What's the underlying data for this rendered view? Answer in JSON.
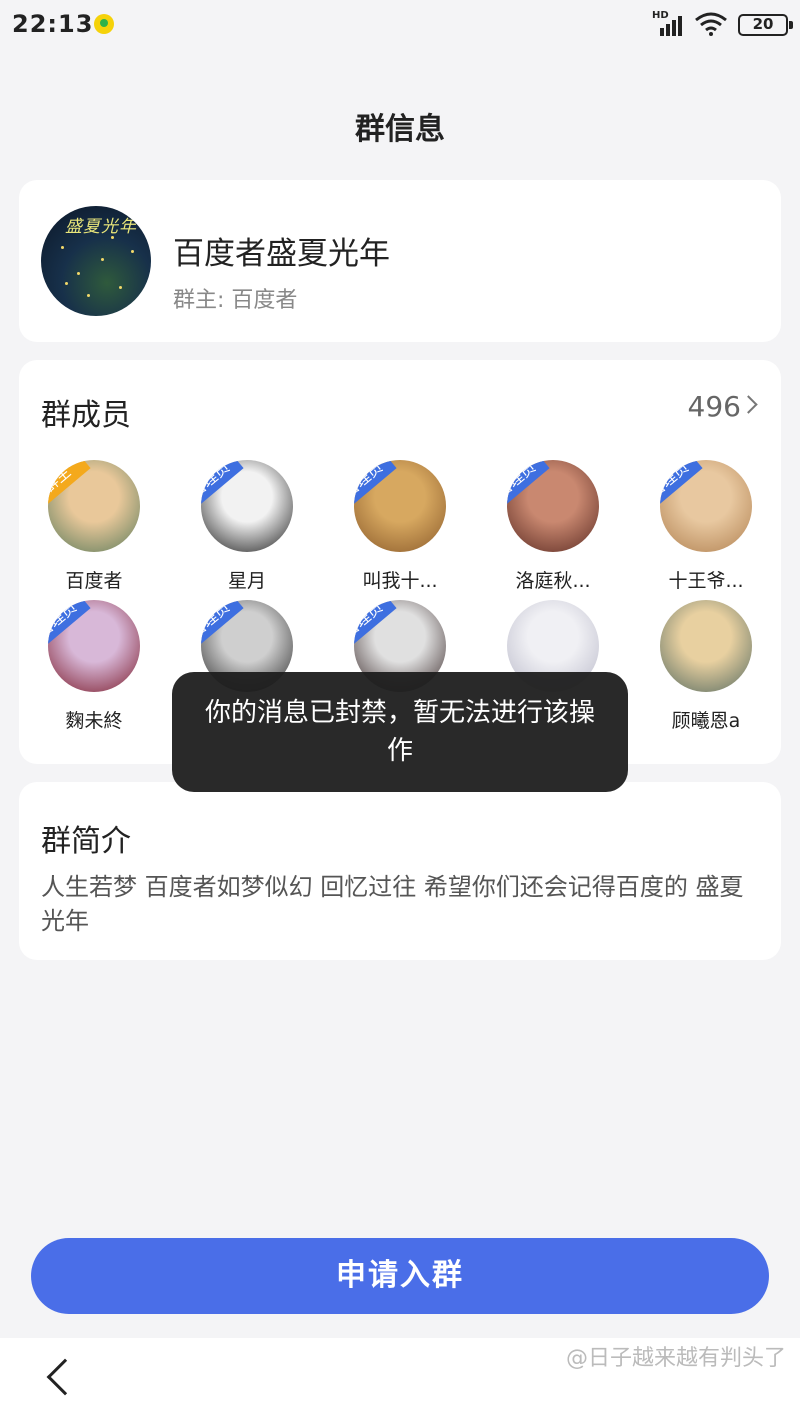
{
  "status_bar": {
    "time": "22:13",
    "network": "HD",
    "battery": "20"
  },
  "header": {
    "title": "群信息"
  },
  "group": {
    "avatar_text": "盛夏光年",
    "name": "百度者盛夏光年",
    "owner": "群主: 百度者"
  },
  "members": {
    "title": "群成员",
    "count": "496",
    "items": [
      {
        "name": "百度者",
        "role": "群主",
        "colors": [
          "#e9c89a",
          "#5a7a5a"
        ]
      },
      {
        "name": "星月",
        "role": "管理员",
        "colors": [
          "#f2f2f2",
          "#1a1a1a"
        ]
      },
      {
        "name": "叫我十...",
        "role": "管理员",
        "colors": [
          "#d7a860",
          "#8a5a2a"
        ]
      },
      {
        "name": "洛庭秋...",
        "role": "管理员",
        "colors": [
          "#c98870",
          "#5a2a22"
        ]
      },
      {
        "name": "十王爷...",
        "role": "管理员",
        "colors": [
          "#e8c8a0",
          "#b08050"
        ]
      },
      {
        "name": "麴未終",
        "role": "管理员",
        "colors": [
          "#d8b8d8",
          "#7a1a2a"
        ]
      },
      {
        "name": "",
        "role": "管理员",
        "colors": [
          "#cfcfcf",
          "#2a2a2a"
        ]
      },
      {
        "name": "",
        "role": "管理员",
        "colors": [
          "#e0e0e0",
          "#3a2a2a"
        ]
      },
      {
        "name": "",
        "role": "",
        "colors": [
          "#f0f0f4",
          "#b8b8c8"
        ]
      },
      {
        "name": "顾曦恩a",
        "role": "",
        "colors": [
          "#e8d0a0",
          "#556a60"
        ]
      }
    ]
  },
  "intro": {
    "title": "群简介",
    "text": "人生若梦 百度者如梦似幻  回忆过往 希望你们还会记得百度的  盛夏光年"
  },
  "toast": {
    "message": "你的消息已封禁，暂无法进行该操作"
  },
  "join_button": {
    "label": "申请入群"
  },
  "watermark": "@日子越来越有判头了"
}
